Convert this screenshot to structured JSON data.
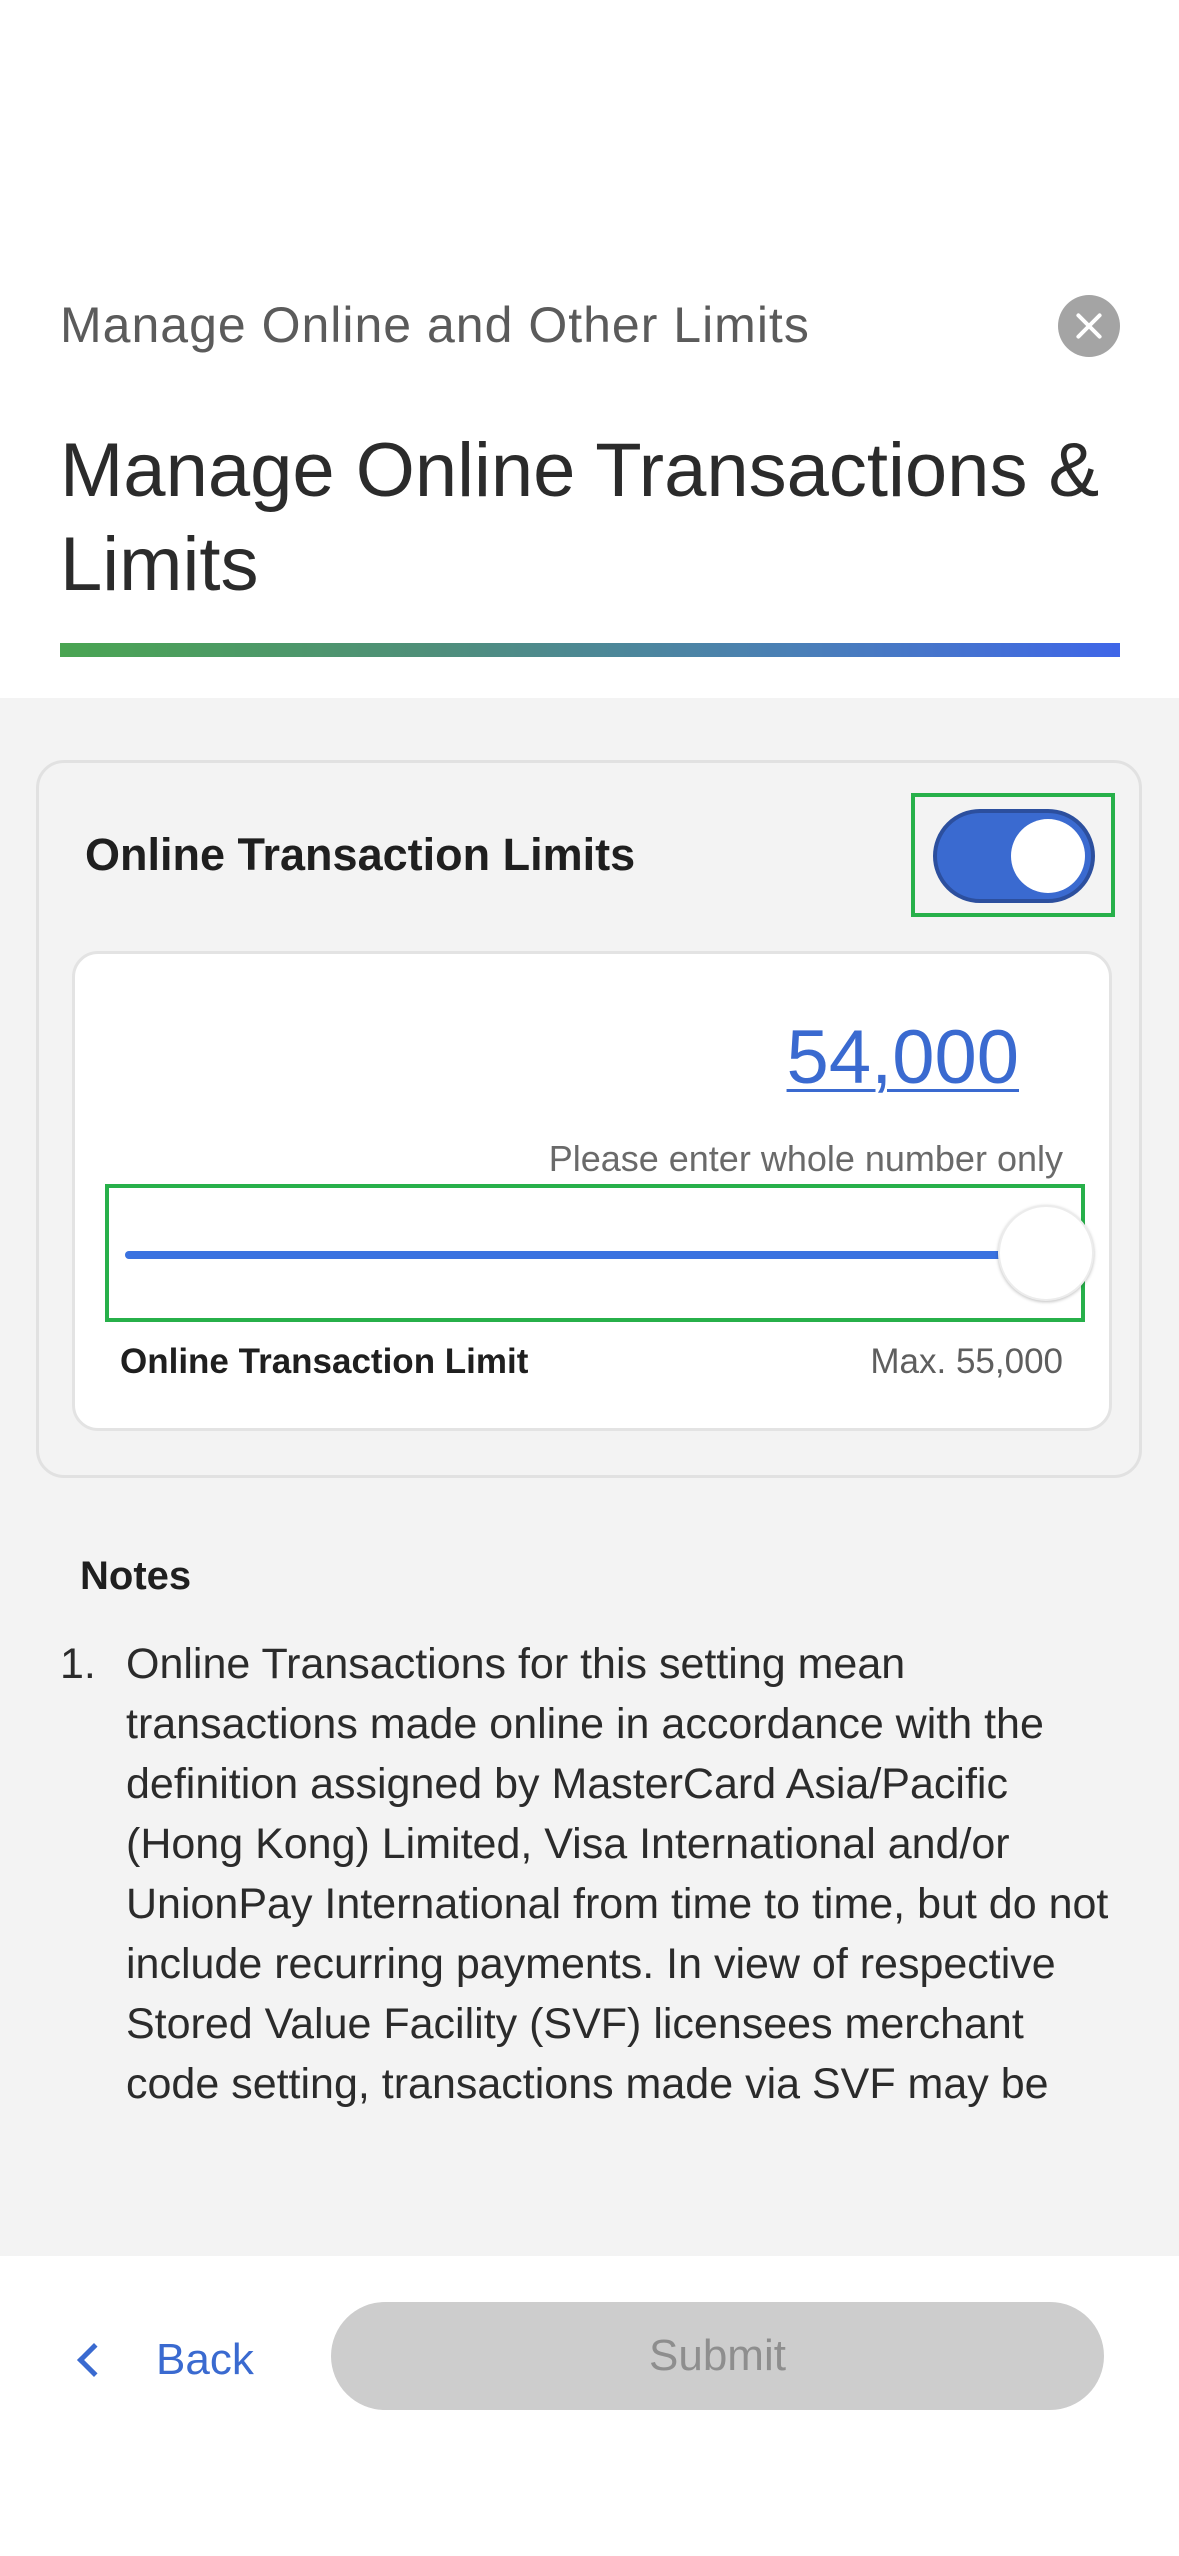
{
  "header": {
    "subtitle": "Manage Online and Other Limits",
    "title": "Manage Online Transactions & Limits",
    "close_icon": "close-icon"
  },
  "limits_card": {
    "title": "Online Transaction Limits",
    "toggle_on": true,
    "amount": "54,000",
    "hint": "Please enter whole number only",
    "slider_fraction": 0.98,
    "range_label": "Online Transaction Limit",
    "max_label": "Max. 55,000"
  },
  "notes": {
    "heading": "Notes",
    "items": [
      {
        "num": "1.",
        "text": "Online Transactions for this setting mean transactions made online in accordance with the definition assigned by MasterCard Asia/Pacific (Hong Kong) Limited, Visa International and/or UnionPay International from time to time, but do not include recurring payments. In view of respective Stored Value Facility (SVF) licensees merchant code setting, transactions made via SVF may be"
      }
    ]
  },
  "footer": {
    "back_label": "Back",
    "back_icon": "chevron-left-icon",
    "submit_label": "Submit"
  },
  "colors": {
    "accent": "#3a6ad0",
    "highlight_box": "#27b04a",
    "disabled": "#cdcdcd"
  }
}
